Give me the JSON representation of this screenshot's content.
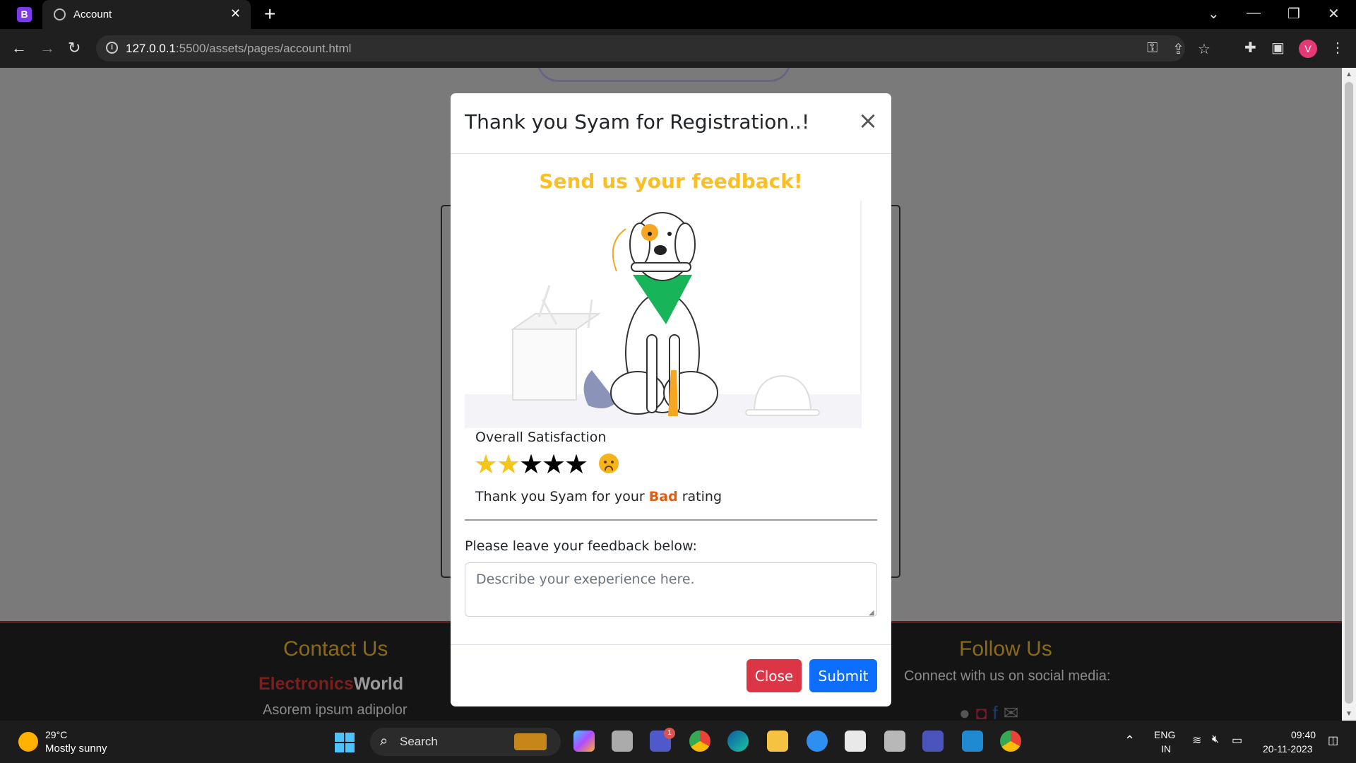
{
  "browser": {
    "tab_title": "Account",
    "url_host": "127.0.0.1",
    "url_path": ":5500/assets/pages/account.html",
    "app_badge": "B",
    "profile_initial": "V"
  },
  "modal": {
    "title": "Thank you Syam for Registration..!",
    "close_glyph": "×",
    "feedback_heading": "Send us your feedback!",
    "satisfaction_label": "Overall Satisfaction",
    "rating": {
      "value": 2,
      "max": 5
    },
    "rating_text_prefix": "Thank you Syam for your",
    "rating_word": "Bad",
    "rating_text_suffix": "rating",
    "feedback_label": "Please leave your feedback below:",
    "feedback_placeholder": "Describe your exeperience here.",
    "close_button": "Close",
    "submit_button": "Submit"
  },
  "footer": {
    "contact_heading": "Contact Us",
    "brand_red": "Electronics",
    "brand_white": "World",
    "lorem": "Asorem ipsum adipolor",
    "follow_heading": "Follow Us",
    "social_text": "Connect with us on social media:"
  },
  "taskbar": {
    "temperature": "29°C",
    "weather": "Mostly sunny",
    "search": "Search",
    "lang_top": "ENG",
    "lang_bottom": "IN",
    "time": "09:40",
    "date": "20-11-2023",
    "teams_badge": "1"
  },
  "colors": {
    "accent_heading": "#fbbf24",
    "bad_word": "#e8590c",
    "close_btn": "#dc3545",
    "submit_btn": "#0d6efd"
  }
}
